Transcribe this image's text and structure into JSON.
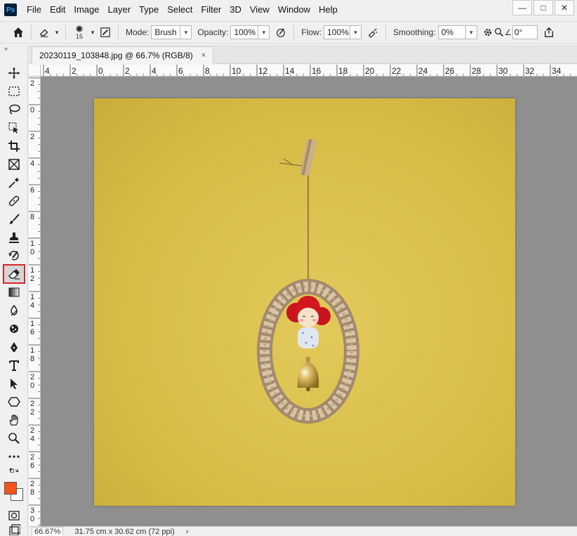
{
  "app": {
    "logo": "Ps"
  },
  "menu": [
    "File",
    "Edit",
    "Image",
    "Layer",
    "Type",
    "Select",
    "Filter",
    "3D",
    "View",
    "Window",
    "Help"
  ],
  "window_controls": {
    "minimize": "—",
    "maximize": "□",
    "close": "✕"
  },
  "options": {
    "brush_size": "15",
    "mode_label": "Mode:",
    "mode_value": "Brush",
    "opacity_label": "Opacity:",
    "opacity_value": "100%",
    "flow_label": "Flow:",
    "flow_value": "100%",
    "smoothing_label": "Smoothing:",
    "smoothing_value": "0%",
    "angle_value": "0°"
  },
  "document": {
    "tab_title": "20230119_103848.jpg @ 66.7% (RGB/8)",
    "close_glyph": "×"
  },
  "ruler_h": [
    "4",
    "2",
    "0",
    "2",
    "4",
    "6",
    "8",
    "10",
    "12",
    "14",
    "16",
    "18",
    "20",
    "22",
    "24",
    "26",
    "28",
    "30",
    "32",
    "34"
  ],
  "ruler_v": [
    "2",
    "0",
    "2",
    "4",
    "6",
    "8",
    "10",
    "12",
    "14",
    "16",
    "18",
    "20",
    "22",
    "24",
    "26",
    "28",
    "30"
  ],
  "status": {
    "zoom": "66.67%",
    "dimensions": "31.75 cm x 30.62 cm (72 ppi)",
    "arrow": "›"
  },
  "colors": {
    "foreground": "#f4541d",
    "background": "#ffffff",
    "canvas_yellow": "#d9be4a",
    "workspace_gray": "#8f8f8f",
    "active_tool_outline": "#d9262c"
  },
  "tools": [
    "move-icon",
    "marquee-icon",
    "lasso-icon",
    "object-select-icon",
    "crop-icon",
    "frame-icon",
    "eyedropper-icon",
    "healing-icon",
    "brush-icon",
    "stamp-icon",
    "history-brush-icon",
    "eraser-icon",
    "gradient-icon",
    "blur-icon",
    "dodge-icon",
    "pen-icon",
    "type-icon",
    "path-select-icon",
    "shape-icon",
    "hand-icon",
    "zoom-icon",
    "more-tools-icon"
  ],
  "active_tool": "eraser-icon"
}
